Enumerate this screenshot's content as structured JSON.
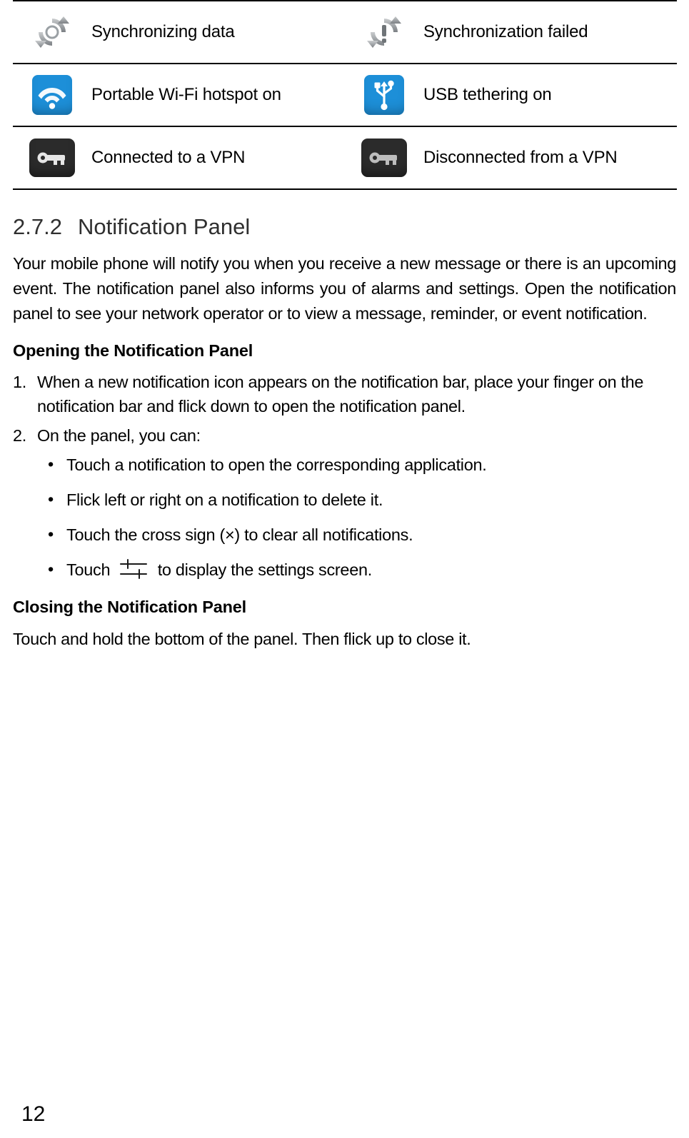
{
  "icon_table": {
    "rows": [
      {
        "left": {
          "icon": "sync-icon",
          "label": "Synchronizing data"
        },
        "right": {
          "icon": "sync-failed-icon",
          "label": "Synchronization failed"
        }
      },
      {
        "left": {
          "icon": "wifi-hotspot-icon",
          "label": "Portable Wi-Fi hotspot on"
        },
        "right": {
          "icon": "usb-tethering-icon",
          "label": "USB tethering on"
        }
      },
      {
        "left": {
          "icon": "vpn-connected-icon",
          "label": "Connected to a VPN"
        },
        "right": {
          "icon": "vpn-disconnected-icon",
          "label": "Disconnected from a VPN"
        }
      }
    ]
  },
  "section": {
    "number": "2.7.2",
    "title": "Notification Panel",
    "intro": "Your mobile phone will notify you when you receive a new message or there is an upcoming event. The notification panel also informs you of alarms and settings. Open the notification panel to see your network operator or to view a message, reminder, or event notification.",
    "opening_heading": "Opening the Notification Panel",
    "steps": [
      {
        "marker": "1.",
        "text": "When a new notification icon appears on the notification bar, place your finger on the notification bar and flick down to open the notification panel."
      },
      {
        "marker": "2.",
        "text": "On the panel, you can:"
      }
    ],
    "bullets": [
      {
        "text": "Touch a notification to open the corresponding application."
      },
      {
        "text": "Flick left or right on a notification to delete it."
      },
      {
        "text": "Touch the cross sign (×) to clear all notifications."
      },
      {
        "text_before": "Touch",
        "icon": "settings-sliders-icon",
        "text_after": "to display the settings screen."
      }
    ],
    "closing_heading": "Closing the Notification Panel",
    "closing_text": "Touch and hold the bottom of the panel. Then flick up to close it."
  },
  "footer": {
    "page_number": "12"
  },
  "colors": {
    "accent_blue": "#1d8fd8",
    "vpn_dark": "#2b2b2b",
    "heading_grey": "#2f2f2f"
  }
}
